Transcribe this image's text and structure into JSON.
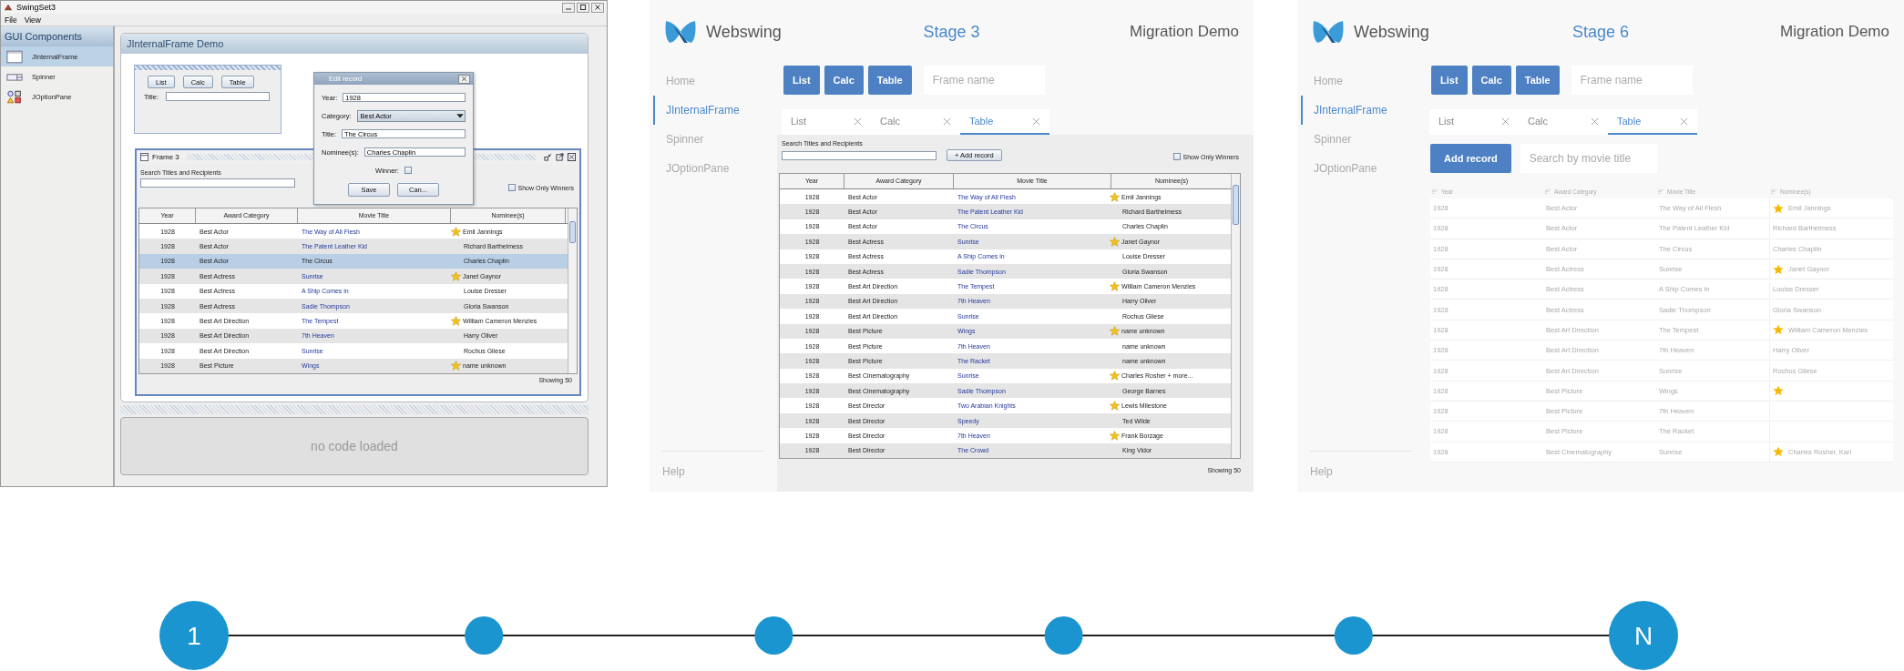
{
  "swingset": {
    "title": "SwingSet3",
    "menu": [
      "File",
      "View"
    ],
    "sidebar": {
      "title": "GUI Components",
      "items": [
        {
          "label": "JInternalFrame",
          "kind": "frame",
          "selected": true
        },
        {
          "label": "Spinner",
          "kind": "spinner",
          "selected": false
        },
        {
          "label": "JOptionPane",
          "kind": "option-pane",
          "selected": false
        }
      ]
    },
    "demo": {
      "title": "JInternalFrame Demo",
      "launcher": {
        "buttons": [
          "List",
          "Calc",
          "Table"
        ],
        "title_label": "Title:"
      },
      "dialog": {
        "title": "Edit record",
        "fields": [
          {
            "label": "Year:",
            "value": "1928",
            "kind": "text"
          },
          {
            "label": "Category:",
            "value": "Best Actor",
            "kind": "dropdown"
          },
          {
            "label": "Title:",
            "value": "The Circus",
            "kind": "text"
          },
          {
            "label": "Nominee(s):",
            "value": "Charles Chaplin",
            "kind": "text"
          },
          {
            "label": "Winner:",
            "kind": "checkbox",
            "checked": false
          }
        ],
        "buttons": [
          "Save",
          "Can..."
        ]
      },
      "frame": {
        "title": "Frame 3",
        "search_label": "Search Titles and Recipients",
        "winners_only": {
          "label": "Show Only Winners",
          "checked": false
        },
        "columns": [
          "Year",
          "Award Category",
          "Movie Title",
          "Nominee(s)"
        ],
        "rows": [
          {
            "year": "1928",
            "category": "Best Actor",
            "title": "The Way of All Flesh",
            "nominee": "Emil Jannings",
            "winner": true,
            "selected": false
          },
          {
            "year": "1928",
            "category": "Best Actor",
            "title": "The Patent Leather Kid",
            "nominee": "Richard Barthelmess",
            "winner": false,
            "selected": false
          },
          {
            "year": "1928",
            "category": "Best Actor",
            "title": "The Circus",
            "nominee": "Charles Chaplin",
            "winner": false,
            "selected": true
          },
          {
            "year": "1928",
            "category": "Best Actress",
            "title": "Sunrise",
            "nominee": "Janet Gaynor",
            "winner": true,
            "selected": false
          },
          {
            "year": "1928",
            "category": "Best Actress",
            "title": "A Ship Comes in",
            "nominee": "Louise Dresser",
            "winner": false,
            "selected": false
          },
          {
            "year": "1928",
            "category": "Best Actress",
            "title": "Sadie Thompson",
            "nominee": "Gloria Swanson",
            "winner": false,
            "selected": false
          },
          {
            "year": "1928",
            "category": "Best Art Direction",
            "title": "The Tempest",
            "nominee": "William Cameron Menzies",
            "winner": true,
            "selected": false
          },
          {
            "year": "1928",
            "category": "Best Art Direction",
            "title": "7th Heaven",
            "nominee": "Harry Oliver",
            "winner": false,
            "selected": false
          },
          {
            "year": "1928",
            "category": "Best Art Direction",
            "title": "Sunrise",
            "nominee": "Rochus Gliese",
            "winner": false,
            "selected": false
          },
          {
            "year": "1928",
            "category": "Best Picture",
            "title": "Wings",
            "nominee": "name unknown",
            "winner": true,
            "selected": false
          }
        ],
        "footer": "Showing 50"
      }
    },
    "status": "no code loaded"
  },
  "stages": [
    {
      "kind": "swing",
      "brand": "Webswing",
      "stage": "Stage 3",
      "title": "Migration Demo",
      "nav": [
        {
          "label": "Home",
          "selected": false
        },
        {
          "label": "JInternalFrame",
          "selected": true
        },
        {
          "label": "Spinner",
          "selected": false
        },
        {
          "label": "JOptionPane",
          "selected": false
        }
      ],
      "help": "Help",
      "buttons": [
        "List",
        "Calc",
        "Table"
      ],
      "frame_name_placeholder": "Frame name",
      "tabs": [
        {
          "label": "List",
          "selected": false
        },
        {
          "label": "Calc",
          "selected": false
        },
        {
          "label": "Table",
          "selected": true
        }
      ],
      "search_label": "Search Titles and Recipients",
      "add_button": "+ Add record",
      "winners_only": {
        "label": "Show Only Winners",
        "checked": false
      },
      "columns": [
        "Year",
        "Award Category",
        "Movie Title",
        "Nominee(s)"
      ],
      "rows": [
        {
          "year": "1928",
          "category": "Best Actor",
          "title": "The Way of All Flesh",
          "nominee": "Emil Jannings",
          "winner": true
        },
        {
          "year": "1928",
          "category": "Best Actor",
          "title": "The Patent Leather Kid",
          "nominee": "Richard Barthelmess",
          "winner": false
        },
        {
          "year": "1928",
          "category": "Best Actor",
          "title": "The Circus",
          "nominee": "Charles Chaplin",
          "winner": false
        },
        {
          "year": "1928",
          "category": "Best Actress",
          "title": "Sunrise",
          "nominee": "Janet Gaynor",
          "winner": true
        },
        {
          "year": "1928",
          "category": "Best Actress",
          "title": "A Ship Comes in",
          "nominee": "Louise Dresser",
          "winner": false
        },
        {
          "year": "1928",
          "category": "Best Actress",
          "title": "Sadie Thompson",
          "nominee": "Gloria Swanson",
          "winner": false
        },
        {
          "year": "1928",
          "category": "Best Art Direction",
          "title": "The Tempest",
          "nominee": "William Cameron Menzies",
          "winner": true
        },
        {
          "year": "1928",
          "category": "Best Art Direction",
          "title": "7th Heaven",
          "nominee": "Harry Oliver",
          "winner": false
        },
        {
          "year": "1928",
          "category": "Best Art Direction",
          "title": "Sunrise",
          "nominee": "Rochus Gliese",
          "winner": false
        },
        {
          "year": "1928",
          "category": "Best Picture",
          "title": "Wings",
          "nominee": "name unknown",
          "winner": true
        },
        {
          "year": "1928",
          "category": "Best Picture",
          "title": "7th Heaven",
          "nominee": "name unknown",
          "winner": false
        },
        {
          "year": "1928",
          "category": "Best Picture",
          "title": "The Racket",
          "nominee": "name unknown",
          "winner": false
        },
        {
          "year": "1928",
          "category": "Best Cinematography",
          "title": "Sunrise",
          "nominee": "Charles Rosher + more...",
          "winner": true
        },
        {
          "year": "1928",
          "category": "Best Cinematography",
          "title": "Sadie Thompson",
          "nominee": "George Barnes",
          "winner": false
        },
        {
          "year": "1928",
          "category": "Best Director",
          "title": "Two Arabian Knights",
          "nominee": "Lewis Milestone",
          "winner": true
        },
        {
          "year": "1928",
          "category": "Best Director",
          "title": "Speedy",
          "nominee": "Ted Wilde",
          "winner": false
        },
        {
          "year": "1928",
          "category": "Best Director",
          "title": "7th Heaven",
          "nominee": "Frank Borzage",
          "winner": true
        },
        {
          "year": "1928",
          "category": "Best Director",
          "title": "The Crowd",
          "nominee": "King Vidor",
          "winner": false
        }
      ],
      "footer": "Showing 50"
    },
    {
      "kind": "web",
      "brand": "Webswing",
      "stage": "Stage 6",
      "title": "Migration Demo",
      "nav": [
        {
          "label": "Home",
          "selected": false
        },
        {
          "label": "JInternalFrame",
          "selected": true
        },
        {
          "label": "Spinner",
          "selected": false
        },
        {
          "label": "JOptionPane",
          "selected": false
        }
      ],
      "help": "Help",
      "buttons": [
        "List",
        "Calc",
        "Table"
      ],
      "frame_name_placeholder": "Frame name",
      "tabs": [
        {
          "label": "List",
          "selected": false
        },
        {
          "label": "Calc",
          "selected": false
        },
        {
          "label": "Table",
          "selected": true
        }
      ],
      "add_button": "Add record",
      "search_placeholder": "Search by movie title",
      "columns": [
        "Year",
        "Award Category",
        "Movie Title",
        "Nominee(s)"
      ],
      "rows": [
        {
          "year": "1928",
          "category": "Best Actor",
          "title": "The Way of All Flesh",
          "nominee": "Emil Jannings",
          "winner": true
        },
        {
          "year": "1928",
          "category": "Best Actor",
          "title": "The Patent Leather Kid",
          "nominee": "Richard Barthelmess",
          "winner": false
        },
        {
          "year": "1928",
          "category": "Best Actor",
          "title": "The Circus",
          "nominee": "Charles Chaplin",
          "winner": false
        },
        {
          "year": "1928",
          "category": "Best Actress",
          "title": "Sunrise",
          "nominee": "Janet Gaynor",
          "winner": true
        },
        {
          "year": "1928",
          "category": "Best Actress",
          "title": "A Ship Comes in",
          "nominee": "Louise Dresser",
          "winner": false
        },
        {
          "year": "1928",
          "category": "Best Actress",
          "title": "Sadie Thompson",
          "nominee": "Gloria Swanson",
          "winner": false
        },
        {
          "year": "1928",
          "category": "Best Art Direction",
          "title": "The Tempest",
          "nominee": "William Cameron Menzies",
          "winner": true
        },
        {
          "year": "1928",
          "category": "Best Art Direction",
          "title": "7th Heaven",
          "nominee": "Harry Oliver",
          "winner": false
        },
        {
          "year": "1928",
          "category": "Best Art Direction",
          "title": "Sunrise",
          "nominee": "Rochus Gliese",
          "winner": false
        },
        {
          "year": "1928",
          "category": "Best Picture",
          "title": "Wings",
          "winner": true
        },
        {
          "year": "1928",
          "category": "Best Picture",
          "title": "7th Heaven",
          "winner": false
        },
        {
          "year": "1928",
          "category": "Best Picture",
          "title": "The Racket",
          "winner": false
        },
        {
          "year": "1928",
          "category": "Best Cinematography",
          "title": "Sunrise",
          "nominee": "Charles Rosher, Karl",
          "winner": true
        }
      ]
    }
  ],
  "timeline": {
    "steps": [
      {
        "kind": "major",
        "label": "1"
      },
      {
        "kind": "minor"
      },
      {
        "kind": "minor"
      },
      {
        "kind": "minor"
      },
      {
        "kind": "minor"
      },
      {
        "kind": "major",
        "label": "N"
      }
    ]
  }
}
